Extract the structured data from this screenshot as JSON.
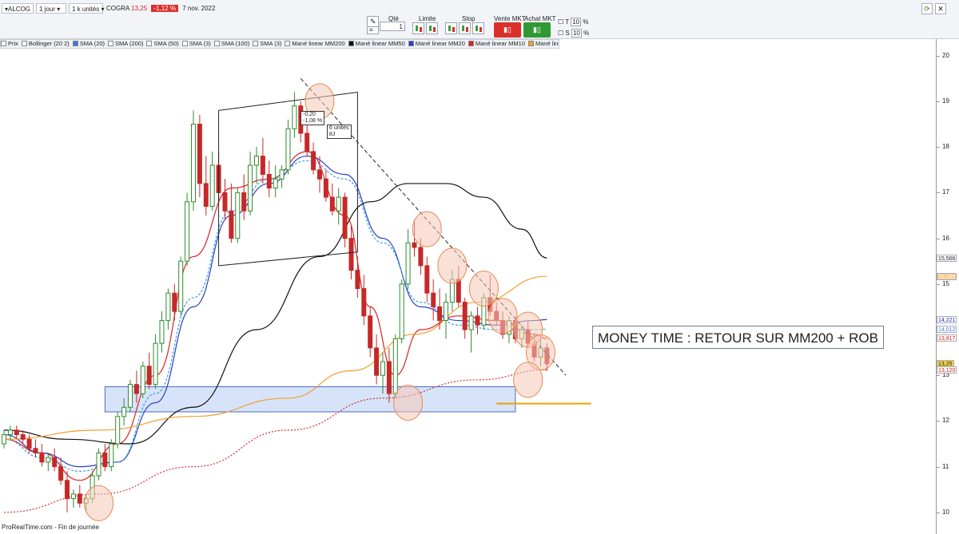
{
  "toolbar": {
    "instrument": "ALCOG",
    "period": "1 jour",
    "units": "1 k unités",
    "ticker": "COGRA",
    "price": "13,25",
    "change": "-1,12 %",
    "date": "7 nov. 2022",
    "qty_label": "Qté",
    "qty_value": "1",
    "limit_label": "Limite",
    "stop_label": "Stop",
    "sell_label": "Vente MKT",
    "buy_label": "Achat MKT",
    "t_label": "T",
    "t_value": "10",
    "s_label": "S",
    "s_value": "10",
    "pct_sign": "%",
    "refresh_icon": "refresh-icon",
    "close_icon": "close-icon",
    "colors": {
      "down": "#d9302c",
      "up": "#3a9a3a"
    }
  },
  "legend": [
    {
      "label": "Prix",
      "color": "#ffffff"
    },
    {
      "label": "Bollinger (20 2)",
      "color": "#ffffff"
    },
    {
      "label": "SMA (20)",
      "color": "#3a7bd5"
    },
    {
      "label": "SMA (200)",
      "color": "#ffffff"
    },
    {
      "label": "SMA (50)",
      "color": "#ffffff"
    },
    {
      "label": "SMA (3)",
      "color": "#ffffff"
    },
    {
      "label": "SMA (100)",
      "color": "#ffffff"
    },
    {
      "label": "SMA (3)",
      "color": "#ffffff"
    },
    {
      "label": "Mané linear MM200",
      "color": "#ffffff"
    },
    {
      "label": "Mané linear MM50",
      "color": "#111111"
    },
    {
      "label": "Mané linear MM20",
      "color": "#2b3fc4"
    },
    {
      "label": "Mané linear MM10",
      "color": "#e02020"
    },
    {
      "label": "Mané linear MM100",
      "color": "#f0a030"
    }
  ],
  "annotation": {
    "callout": "MONEY TIME : RETOUR SUR MM200 + ROB",
    "info_line1": "-0,20",
    "info_line2": "-1,08 %",
    "units_line1": "6 unités",
    "units_line2": "8J"
  },
  "footer": "ProRealTime.com - Fin de journée",
  "price_tags": [
    {
      "value": "15,566",
      "price": 15.566,
      "color": "#ffffff",
      "text": "#222222"
    },
    {
      "value": "15,165",
      "price": 15.165,
      "color": "#f5c98a",
      "text": "#ffffff"
    },
    {
      "value": "14,221",
      "price": 14.221,
      "color": "#ffffff",
      "text": "#1a2aa0"
    },
    {
      "value": "14,012",
      "price": 14.012,
      "color": "#ffffff",
      "text": "#3a7bd5"
    },
    {
      "value": "13,817",
      "price": 13.817,
      "color": "#ffffff",
      "text": "#d02020"
    },
    {
      "value": "13,25",
      "price": 13.25,
      "color": "#f3d34a",
      "text": "#222222"
    },
    {
      "value": "13,120",
      "price": 13.12,
      "color": "#ffffff",
      "text": "#d02020"
    }
  ],
  "chart_data": {
    "type": "candlestick",
    "title": "",
    "ylim": [
      9.7,
      20.1
    ],
    "yticks": [
      10,
      11,
      12,
      13,
      14,
      15,
      16,
      17,
      18,
      19,
      20
    ],
    "grid": false,
    "ohlc": [
      [
        11.5,
        11.8,
        11.4,
        11.7
      ],
      [
        11.7,
        11.9,
        11.6,
        11.8
      ],
      [
        11.8,
        11.9,
        11.6,
        11.7
      ],
      [
        11.7,
        11.8,
        11.5,
        11.6
      ],
      [
        11.6,
        11.7,
        11.3,
        11.4
      ],
      [
        11.4,
        11.6,
        11.2,
        11.3
      ],
      [
        11.3,
        11.5,
        11.0,
        11.1
      ],
      [
        11.1,
        11.3,
        10.9,
        11.2
      ],
      [
        11.2,
        11.4,
        10.9,
        11.0
      ],
      [
        11.0,
        11.2,
        10.6,
        10.7
      ],
      [
        10.7,
        10.9,
        10.0,
        10.3
      ],
      [
        10.3,
        10.5,
        10.1,
        10.4
      ],
      [
        10.4,
        10.6,
        10.1,
        10.2
      ],
      [
        10.2,
        10.4,
        10.0,
        10.3
      ],
      [
        10.3,
        10.9,
        10.2,
        10.8
      ],
      [
        10.8,
        11.4,
        10.7,
        11.3
      ],
      [
        11.3,
        11.5,
        10.9,
        11.0
      ],
      [
        11.0,
        11.6,
        10.9,
        11.5
      ],
      [
        11.5,
        12.2,
        11.4,
        12.1
      ],
      [
        12.1,
        12.5,
        11.9,
        12.3
      ],
      [
        12.3,
        12.9,
        12.2,
        12.8
      ],
      [
        12.8,
        13.1,
        12.4,
        12.6
      ],
      [
        12.6,
        13.3,
        12.5,
        13.2
      ],
      [
        13.2,
        13.5,
        12.7,
        12.8
      ],
      [
        12.8,
        13.9,
        12.7,
        13.7
      ],
      [
        13.7,
        14.4,
        13.5,
        14.2
      ],
      [
        14.2,
        14.9,
        14.0,
        14.8
      ],
      [
        14.8,
        15.0,
        14.2,
        14.4
      ],
      [
        14.4,
        15.6,
        14.3,
        15.5
      ],
      [
        15.5,
        17.0,
        15.4,
        16.8
      ],
      [
        16.8,
        18.8,
        16.6,
        18.5
      ],
      [
        18.5,
        18.7,
        16.9,
        17.2
      ],
      [
        17.2,
        17.8,
        16.5,
        16.7
      ],
      [
        16.7,
        17.9,
        16.6,
        17.6
      ],
      [
        17.6,
        17.9,
        16.8,
        17.0
      ],
      [
        17.0,
        17.3,
        16.4,
        16.6
      ],
      [
        16.6,
        17.2,
        15.9,
        16.0
      ],
      [
        16.0,
        17.1,
        15.9,
        17.0
      ],
      [
        17.0,
        17.4,
        16.4,
        16.6
      ],
      [
        16.6,
        17.9,
        16.5,
        17.6
      ],
      [
        17.6,
        18.0,
        17.2,
        17.8
      ],
      [
        17.8,
        18.2,
        17.2,
        17.4
      ],
      [
        17.4,
        17.7,
        16.9,
        17.1
      ],
      [
        17.1,
        17.6,
        16.9,
        17.3
      ],
      [
        17.3,
        17.6,
        17.1,
        17.5
      ],
      [
        17.5,
        18.6,
        17.4,
        18.4
      ],
      [
        18.4,
        19.2,
        18.2,
        18.9
      ],
      [
        18.9,
        19.0,
        18.1,
        18.3
      ],
      [
        18.3,
        18.6,
        17.8,
        17.9
      ],
      [
        17.9,
        18.1,
        17.4,
        17.5
      ],
      [
        17.5,
        17.8,
        17.0,
        17.3
      ],
      [
        17.3,
        17.5,
        16.8,
        16.9
      ],
      [
        16.9,
        17.2,
        16.5,
        16.6
      ],
      [
        16.6,
        17.1,
        16.3,
        16.9
      ],
      [
        16.9,
        17.0,
        15.8,
        16.0
      ],
      [
        16.0,
        16.3,
        15.1,
        15.3
      ],
      [
        15.3,
        15.6,
        14.7,
        14.9
      ],
      [
        14.9,
        15.2,
        14.1,
        14.3
      ],
      [
        14.3,
        14.5,
        13.4,
        13.6
      ],
      [
        13.6,
        13.9,
        12.8,
        13.0
      ],
      [
        13.0,
        13.5,
        12.6,
        13.3
      ],
      [
        13.3,
        13.6,
        12.4,
        12.6
      ],
      [
        12.6,
        13.9,
        12.5,
        13.8
      ],
      [
        13.8,
        15.1,
        13.7,
        15.0
      ],
      [
        15.0,
        16.2,
        14.9,
        15.9
      ],
      [
        15.9,
        16.4,
        15.6,
        15.8
      ],
      [
        15.8,
        16.0,
        15.2,
        15.4
      ],
      [
        15.4,
        15.6,
        14.6,
        14.8
      ],
      [
        14.8,
        15.1,
        14.2,
        14.5
      ],
      [
        14.5,
        14.9,
        14.0,
        14.2
      ],
      [
        14.2,
        14.8,
        13.8,
        14.6
      ],
      [
        14.6,
        15.3,
        14.4,
        15.1
      ],
      [
        15.1,
        15.4,
        14.5,
        14.6
      ],
      [
        14.6,
        14.7,
        13.8,
        14.0
      ],
      [
        14.0,
        14.4,
        13.5,
        14.3
      ],
      [
        14.3,
        14.5,
        13.9,
        14.1
      ],
      [
        14.1,
        14.8,
        14.0,
        14.7
      ],
      [
        14.7,
        15.2,
        14.3,
        14.4
      ],
      [
        14.4,
        14.6,
        14.1,
        14.2
      ],
      [
        14.2,
        14.4,
        13.8,
        13.9
      ],
      [
        13.9,
        14.3,
        13.7,
        14.2
      ],
      [
        14.2,
        14.3,
        13.7,
        13.8
      ],
      [
        13.8,
        14.1,
        13.6,
        14.0
      ],
      [
        14.0,
        14.2,
        13.6,
        13.7
      ],
      [
        13.7,
        13.9,
        13.3,
        13.4
      ],
      [
        13.4,
        13.8,
        13.2,
        13.6
      ],
      [
        13.6,
        13.7,
        13.1,
        13.25
      ]
    ],
    "series": [
      {
        "name": "Mané linear MM10",
        "color": "#e02020",
        "dash": "",
        "x": [
          0,
          6,
          12,
          18,
          24,
          30,
          36,
          42,
          48,
          54,
          58,
          62,
          66,
          72,
          78,
          84,
          86
        ],
        "y": [
          11.6,
          11.3,
          10.7,
          11.5,
          13.0,
          15.6,
          17.1,
          17.3,
          17.9,
          16.5,
          14.5,
          13.0,
          14.0,
          14.3,
          14.2,
          13.9,
          13.8
        ]
      },
      {
        "name": "Mané linear MM20",
        "color": "#2b3fc4",
        "dash": "",
        "x": [
          0,
          6,
          12,
          18,
          24,
          30,
          36,
          42,
          48,
          54,
          60,
          66,
          72,
          78,
          84,
          86
        ],
        "y": [
          11.7,
          11.3,
          11.0,
          11.1,
          12.4,
          14.5,
          16.5,
          17.2,
          17.8,
          17.4,
          16.0,
          14.5,
          14.2,
          14.1,
          14.2,
          14.22
        ]
      },
      {
        "name": "SMA (20)",
        "color": "#3aa0e0",
        "dash": "3,2",
        "x": [
          0,
          6,
          12,
          18,
          24,
          30,
          36,
          42,
          48,
          54,
          60,
          66,
          72,
          78,
          84,
          86
        ],
        "y": [
          11.6,
          11.2,
          10.9,
          11.1,
          12.6,
          14.7,
          16.6,
          17.3,
          17.7,
          17.3,
          15.9,
          14.6,
          14.1,
          14.0,
          14.0,
          14.01
        ]
      },
      {
        "name": "Mané linear MM50",
        "color": "#111111",
        "dash": "",
        "x": [
          0,
          10,
          20,
          30,
          40,
          50,
          58,
          64,
          70,
          76,
          82,
          86
        ],
        "y": [
          11.8,
          11.6,
          11.5,
          12.3,
          14.0,
          15.6,
          16.8,
          17.2,
          17.2,
          16.9,
          16.2,
          15.57
        ]
      },
      {
        "name": "Mané linear MM100",
        "color": "#f0a030",
        "dash": "",
        "x": [
          0,
          15,
          30,
          45,
          55,
          65,
          75,
          86
        ],
        "y": [
          11.6,
          11.8,
          12.1,
          12.5,
          13.1,
          13.9,
          14.6,
          15.17
        ]
      },
      {
        "name": "Mané linear MM200",
        "color": "#d03030",
        "dash": "2,2",
        "x": [
          0,
          15,
          30,
          45,
          60,
          75,
          86
        ],
        "y": [
          10.0,
          10.4,
          11.0,
          11.8,
          12.5,
          12.9,
          13.12
        ]
      }
    ],
    "zones": [
      {
        "x0": 16,
        "x1": 81,
        "y0": 12.2,
        "y1": 12.75
      }
    ],
    "support_line": {
      "x0": 78,
      "x1": 93,
      "y": 12.38
    },
    "trendline": {
      "x": [
        47,
        89
      ],
      "y": [
        19.5,
        13.0
      ]
    },
    "channel": {
      "x": [
        34,
        56,
        34,
        56
      ],
      "y": [
        18.8,
        19.2,
        15.4,
        15.7
      ]
    },
    "circles": [
      {
        "x": 15,
        "y": 10.2
      },
      {
        "x": 50,
        "y": 19.0
      },
      {
        "x": 64,
        "y": 12.4
      },
      {
        "x": 67,
        "y": 16.2
      },
      {
        "x": 71,
        "y": 15.4
      },
      {
        "x": 76,
        "y": 14.9
      },
      {
        "x": 79,
        "y": 14.3
      },
      {
        "x": 83,
        "y": 14.0
      },
      {
        "x": 85,
        "y": 13.5
      },
      {
        "x": 83,
        "y": 12.9
      }
    ]
  }
}
